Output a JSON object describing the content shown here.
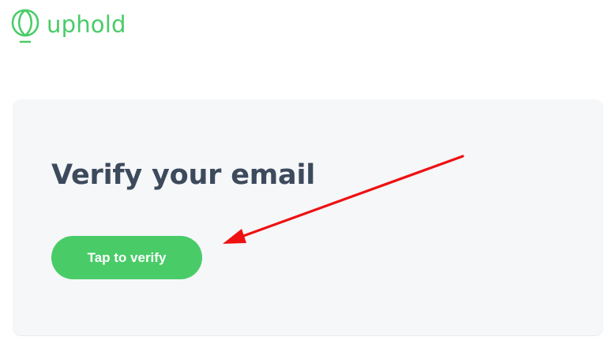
{
  "brand": {
    "name": "uphold",
    "logo_icon": "uphold-leaf-icon",
    "color": "#49cc68"
  },
  "card": {
    "background": "#f5f7f9",
    "title": "Verify your email",
    "title_color": "#3d4a5c",
    "button": {
      "label": "Tap to verify",
      "background": "#49cc68"
    }
  },
  "annotation": {
    "icon": "red-arrow-icon",
    "color": "#ee1111"
  }
}
